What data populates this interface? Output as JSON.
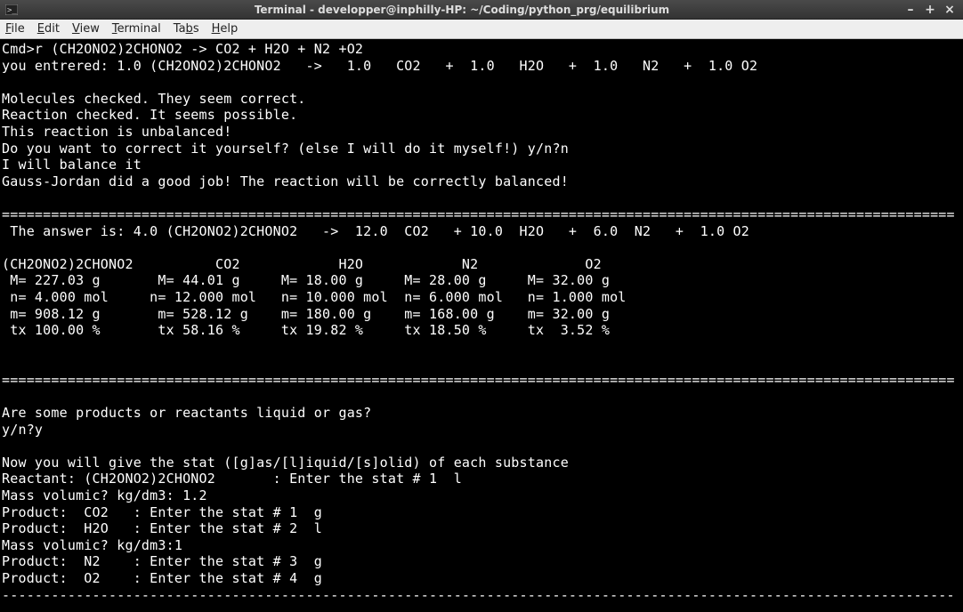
{
  "titlebar": {
    "title": "Terminal - developper@inphilly-HP: ~/Coding/python_prg/equilibrium"
  },
  "win_controls": {
    "minimize": "–",
    "maximize": "+",
    "close": "×"
  },
  "menu": {
    "file": "File",
    "edit": "Edit",
    "view": "View",
    "terminal": "Terminal",
    "tabs": "Tabs",
    "help": "Help"
  },
  "terminal_text": "Cmd>r (CH2ONO2)2CHONO2 -> CO2 + H2O + N2 +O2\nyou entrered: 1.0 (CH2ONO2)2CHONO2   ->   1.0   CO2   +  1.0   H2O   +  1.0   N2   +  1.0 O2\n\nMolecules checked. They seem correct.\nReaction checked. It seems possible.\nThis reaction is unbalanced!\nDo you want to correct it yourself? (else I will do it myself!) y/n?n\nI will balance it\nGauss-Jordan did a good job! The reaction will be correctly balanced!\n\n====================================================================================================================\n The answer is: 4.0 (CH2ONO2)2CHONO2   ->  12.0  CO2   + 10.0  H2O   +  6.0  N2   +  1.0 O2\n\n(CH2ONO2)2CHONO2          CO2            H2O            N2             O2\n M= 227.03 g       M= 44.01 g     M= 18.00 g     M= 28.00 g     M= 32.00 g\n n= 4.000 mol     n= 12.000 mol   n= 10.000 mol  n= 6.000 mol   n= 1.000 mol\n m= 908.12 g       m= 528.12 g    m= 180.00 g    m= 168.00 g    m= 32.00 g\n tx 100.00 %       tx 58.16 %     tx 19.82 %     tx 18.50 %     tx  3.52 %\n\n\n====================================================================================================================\n\nAre some products or reactants liquid or gas?\ny/n?y\n\nNow you will give the stat ([g]as/[l]iquid/[s]olid) of each substance\nReactant: (CH2ONO2)2CHONO2       : Enter the stat # 1  l\nMass volumic? kg/dm3: 1.2\nProduct:  CO2   : Enter the stat # 1  g\nProduct:  H2O   : Enter the stat # 2  l\nMass volumic? kg/dm3:1\nProduct:  N2    : Enter the stat # 3  g\nProduct:  O2    : Enter the stat # 4  g\n--------------------------------------------------------------------------------------------------------------------"
}
